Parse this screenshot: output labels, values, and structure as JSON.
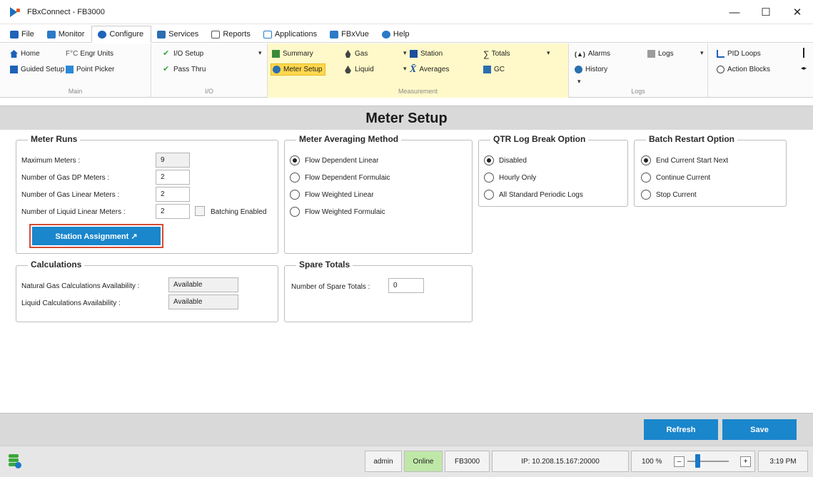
{
  "window": {
    "title": "FBxConnect - FB3000",
    "minimize": "—",
    "maximize": "☐",
    "close": "✕"
  },
  "menu": {
    "tabs": [
      "File",
      "Monitor",
      "Configure",
      "Services",
      "Reports",
      "Applications",
      "FBxVue",
      "Help"
    ],
    "active": "Configure"
  },
  "ribbon": {
    "main": {
      "label": "Main",
      "home": "Home",
      "engr_units": "Engr Units",
      "engr_prefix": "F°C",
      "guided_setup": "Guided Setup",
      "point_picker": "Point Picker"
    },
    "io": {
      "label": "I/O",
      "io_setup": "I/O Setup",
      "pass_thru": "Pass Thru"
    },
    "measurement": {
      "label": "Measurement",
      "summary": "Summary",
      "meter_setup": "Meter Setup",
      "gas": "Gas",
      "liquid": "Liquid",
      "station": "Station",
      "averages": "Averages",
      "totals": "Totals",
      "gc": "GC"
    },
    "logs": {
      "label": "Logs",
      "alarms": "Alarms",
      "history": "History",
      "logs": "Logs"
    },
    "other": {
      "pid_loops": "PID Loops",
      "action_blocks": "Action Blocks"
    }
  },
  "page": {
    "title": "Meter Setup"
  },
  "meter_runs": {
    "legend": "Meter Runs",
    "max_meters_label": "Maximum Meters :",
    "max_meters_value": "9",
    "gas_dp_label": "Number of Gas DP Meters :",
    "gas_dp_value": "2",
    "gas_linear_label": "Number of Gas Linear Meters :",
    "gas_linear_value": "2",
    "liquid_linear_label": "Number of Liquid Linear Meters :",
    "liquid_linear_value": "2",
    "batching_label": "Batching Enabled",
    "station_assignment": "Station Assignment ↗"
  },
  "averaging": {
    "legend": "Meter Averaging Method",
    "options": [
      "Flow Dependent Linear",
      "Flow Dependent Formulaic",
      "Flow Weighted Linear",
      "Flow Weighted Formulaic"
    ],
    "selected": "Flow Dependent Linear"
  },
  "qtr": {
    "legend": "QTR Log Break Option",
    "options": [
      "Disabled",
      "Hourly Only",
      "All Standard Periodic Logs"
    ],
    "selected": "Disabled"
  },
  "batch": {
    "legend": "Batch Restart Option",
    "options": [
      "End Current Start Next",
      "Continue Current",
      "Stop Current"
    ],
    "selected": "End Current Start Next"
  },
  "calculations": {
    "legend": "Calculations",
    "natural_gas_label": "Natural Gas Calculations Availability :",
    "natural_gas_value": "Available",
    "liquid_label": "Liquid Calculations Availability :",
    "liquid_value": "Available"
  },
  "spare_totals": {
    "legend": "Spare Totals",
    "label": "Number of Spare Totals :",
    "value": "0"
  },
  "actions": {
    "refresh": "Refresh",
    "save": "Save"
  },
  "status": {
    "user": "admin",
    "connection": "Online",
    "device": "FB3000",
    "ip": "IP: 10.208.15.167:20000",
    "zoom": "100 %",
    "zoom_minus": "–",
    "zoom_plus": "+",
    "zoom_level_percent": 25,
    "time": "3:19 PM"
  },
  "colors": {
    "accent": "#1a86cc",
    "highlight": "#ffd84d",
    "online": "#bfe8a8",
    "focus_border": "#d84a35"
  }
}
